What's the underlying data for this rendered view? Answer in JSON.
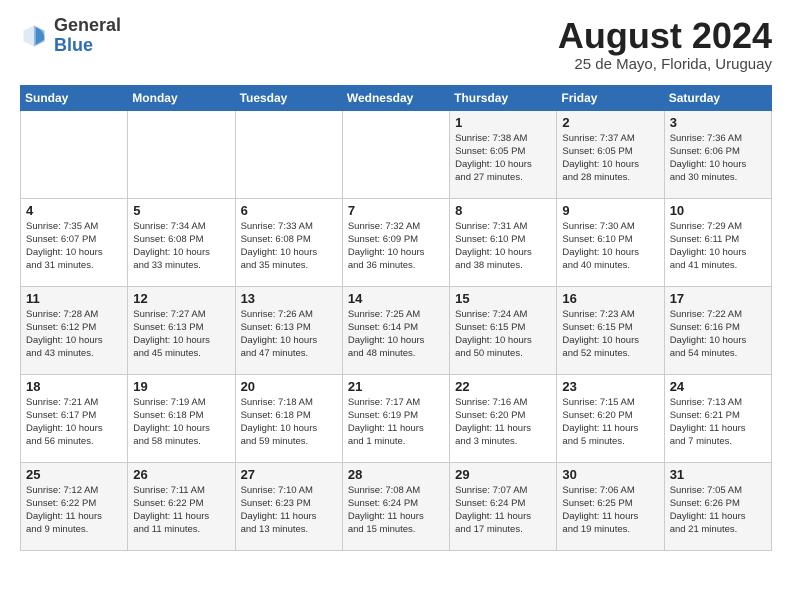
{
  "header": {
    "logo_general": "General",
    "logo_blue": "Blue",
    "month_title": "August 2024",
    "subtitle": "25 de Mayo, Florida, Uruguay"
  },
  "days_of_week": [
    "Sunday",
    "Monday",
    "Tuesday",
    "Wednesday",
    "Thursday",
    "Friday",
    "Saturday"
  ],
  "weeks": [
    [
      {
        "day": "",
        "info": ""
      },
      {
        "day": "",
        "info": ""
      },
      {
        "day": "",
        "info": ""
      },
      {
        "day": "",
        "info": ""
      },
      {
        "day": "1",
        "info": "Sunrise: 7:38 AM\nSunset: 6:05 PM\nDaylight: 10 hours\nand 27 minutes."
      },
      {
        "day": "2",
        "info": "Sunrise: 7:37 AM\nSunset: 6:05 PM\nDaylight: 10 hours\nand 28 minutes."
      },
      {
        "day": "3",
        "info": "Sunrise: 7:36 AM\nSunset: 6:06 PM\nDaylight: 10 hours\nand 30 minutes."
      }
    ],
    [
      {
        "day": "4",
        "info": "Sunrise: 7:35 AM\nSunset: 6:07 PM\nDaylight: 10 hours\nand 31 minutes."
      },
      {
        "day": "5",
        "info": "Sunrise: 7:34 AM\nSunset: 6:08 PM\nDaylight: 10 hours\nand 33 minutes."
      },
      {
        "day": "6",
        "info": "Sunrise: 7:33 AM\nSunset: 6:08 PM\nDaylight: 10 hours\nand 35 minutes."
      },
      {
        "day": "7",
        "info": "Sunrise: 7:32 AM\nSunset: 6:09 PM\nDaylight: 10 hours\nand 36 minutes."
      },
      {
        "day": "8",
        "info": "Sunrise: 7:31 AM\nSunset: 6:10 PM\nDaylight: 10 hours\nand 38 minutes."
      },
      {
        "day": "9",
        "info": "Sunrise: 7:30 AM\nSunset: 6:10 PM\nDaylight: 10 hours\nand 40 minutes."
      },
      {
        "day": "10",
        "info": "Sunrise: 7:29 AM\nSunset: 6:11 PM\nDaylight: 10 hours\nand 41 minutes."
      }
    ],
    [
      {
        "day": "11",
        "info": "Sunrise: 7:28 AM\nSunset: 6:12 PM\nDaylight: 10 hours\nand 43 minutes."
      },
      {
        "day": "12",
        "info": "Sunrise: 7:27 AM\nSunset: 6:13 PM\nDaylight: 10 hours\nand 45 minutes."
      },
      {
        "day": "13",
        "info": "Sunrise: 7:26 AM\nSunset: 6:13 PM\nDaylight: 10 hours\nand 47 minutes."
      },
      {
        "day": "14",
        "info": "Sunrise: 7:25 AM\nSunset: 6:14 PM\nDaylight: 10 hours\nand 48 minutes."
      },
      {
        "day": "15",
        "info": "Sunrise: 7:24 AM\nSunset: 6:15 PM\nDaylight: 10 hours\nand 50 minutes."
      },
      {
        "day": "16",
        "info": "Sunrise: 7:23 AM\nSunset: 6:15 PM\nDaylight: 10 hours\nand 52 minutes."
      },
      {
        "day": "17",
        "info": "Sunrise: 7:22 AM\nSunset: 6:16 PM\nDaylight: 10 hours\nand 54 minutes."
      }
    ],
    [
      {
        "day": "18",
        "info": "Sunrise: 7:21 AM\nSunset: 6:17 PM\nDaylight: 10 hours\nand 56 minutes."
      },
      {
        "day": "19",
        "info": "Sunrise: 7:19 AM\nSunset: 6:18 PM\nDaylight: 10 hours\nand 58 minutes."
      },
      {
        "day": "20",
        "info": "Sunrise: 7:18 AM\nSunset: 6:18 PM\nDaylight: 10 hours\nand 59 minutes."
      },
      {
        "day": "21",
        "info": "Sunrise: 7:17 AM\nSunset: 6:19 PM\nDaylight: 11 hours\nand 1 minute."
      },
      {
        "day": "22",
        "info": "Sunrise: 7:16 AM\nSunset: 6:20 PM\nDaylight: 11 hours\nand 3 minutes."
      },
      {
        "day": "23",
        "info": "Sunrise: 7:15 AM\nSunset: 6:20 PM\nDaylight: 11 hours\nand 5 minutes."
      },
      {
        "day": "24",
        "info": "Sunrise: 7:13 AM\nSunset: 6:21 PM\nDaylight: 11 hours\nand 7 minutes."
      }
    ],
    [
      {
        "day": "25",
        "info": "Sunrise: 7:12 AM\nSunset: 6:22 PM\nDaylight: 11 hours\nand 9 minutes."
      },
      {
        "day": "26",
        "info": "Sunrise: 7:11 AM\nSunset: 6:22 PM\nDaylight: 11 hours\nand 11 minutes."
      },
      {
        "day": "27",
        "info": "Sunrise: 7:10 AM\nSunset: 6:23 PM\nDaylight: 11 hours\nand 13 minutes."
      },
      {
        "day": "28",
        "info": "Sunrise: 7:08 AM\nSunset: 6:24 PM\nDaylight: 11 hours\nand 15 minutes."
      },
      {
        "day": "29",
        "info": "Sunrise: 7:07 AM\nSunset: 6:24 PM\nDaylight: 11 hours\nand 17 minutes."
      },
      {
        "day": "30",
        "info": "Sunrise: 7:06 AM\nSunset: 6:25 PM\nDaylight: 11 hours\nand 19 minutes."
      },
      {
        "day": "31",
        "info": "Sunrise: 7:05 AM\nSunset: 6:26 PM\nDaylight: 11 hours\nand 21 minutes."
      }
    ]
  ]
}
